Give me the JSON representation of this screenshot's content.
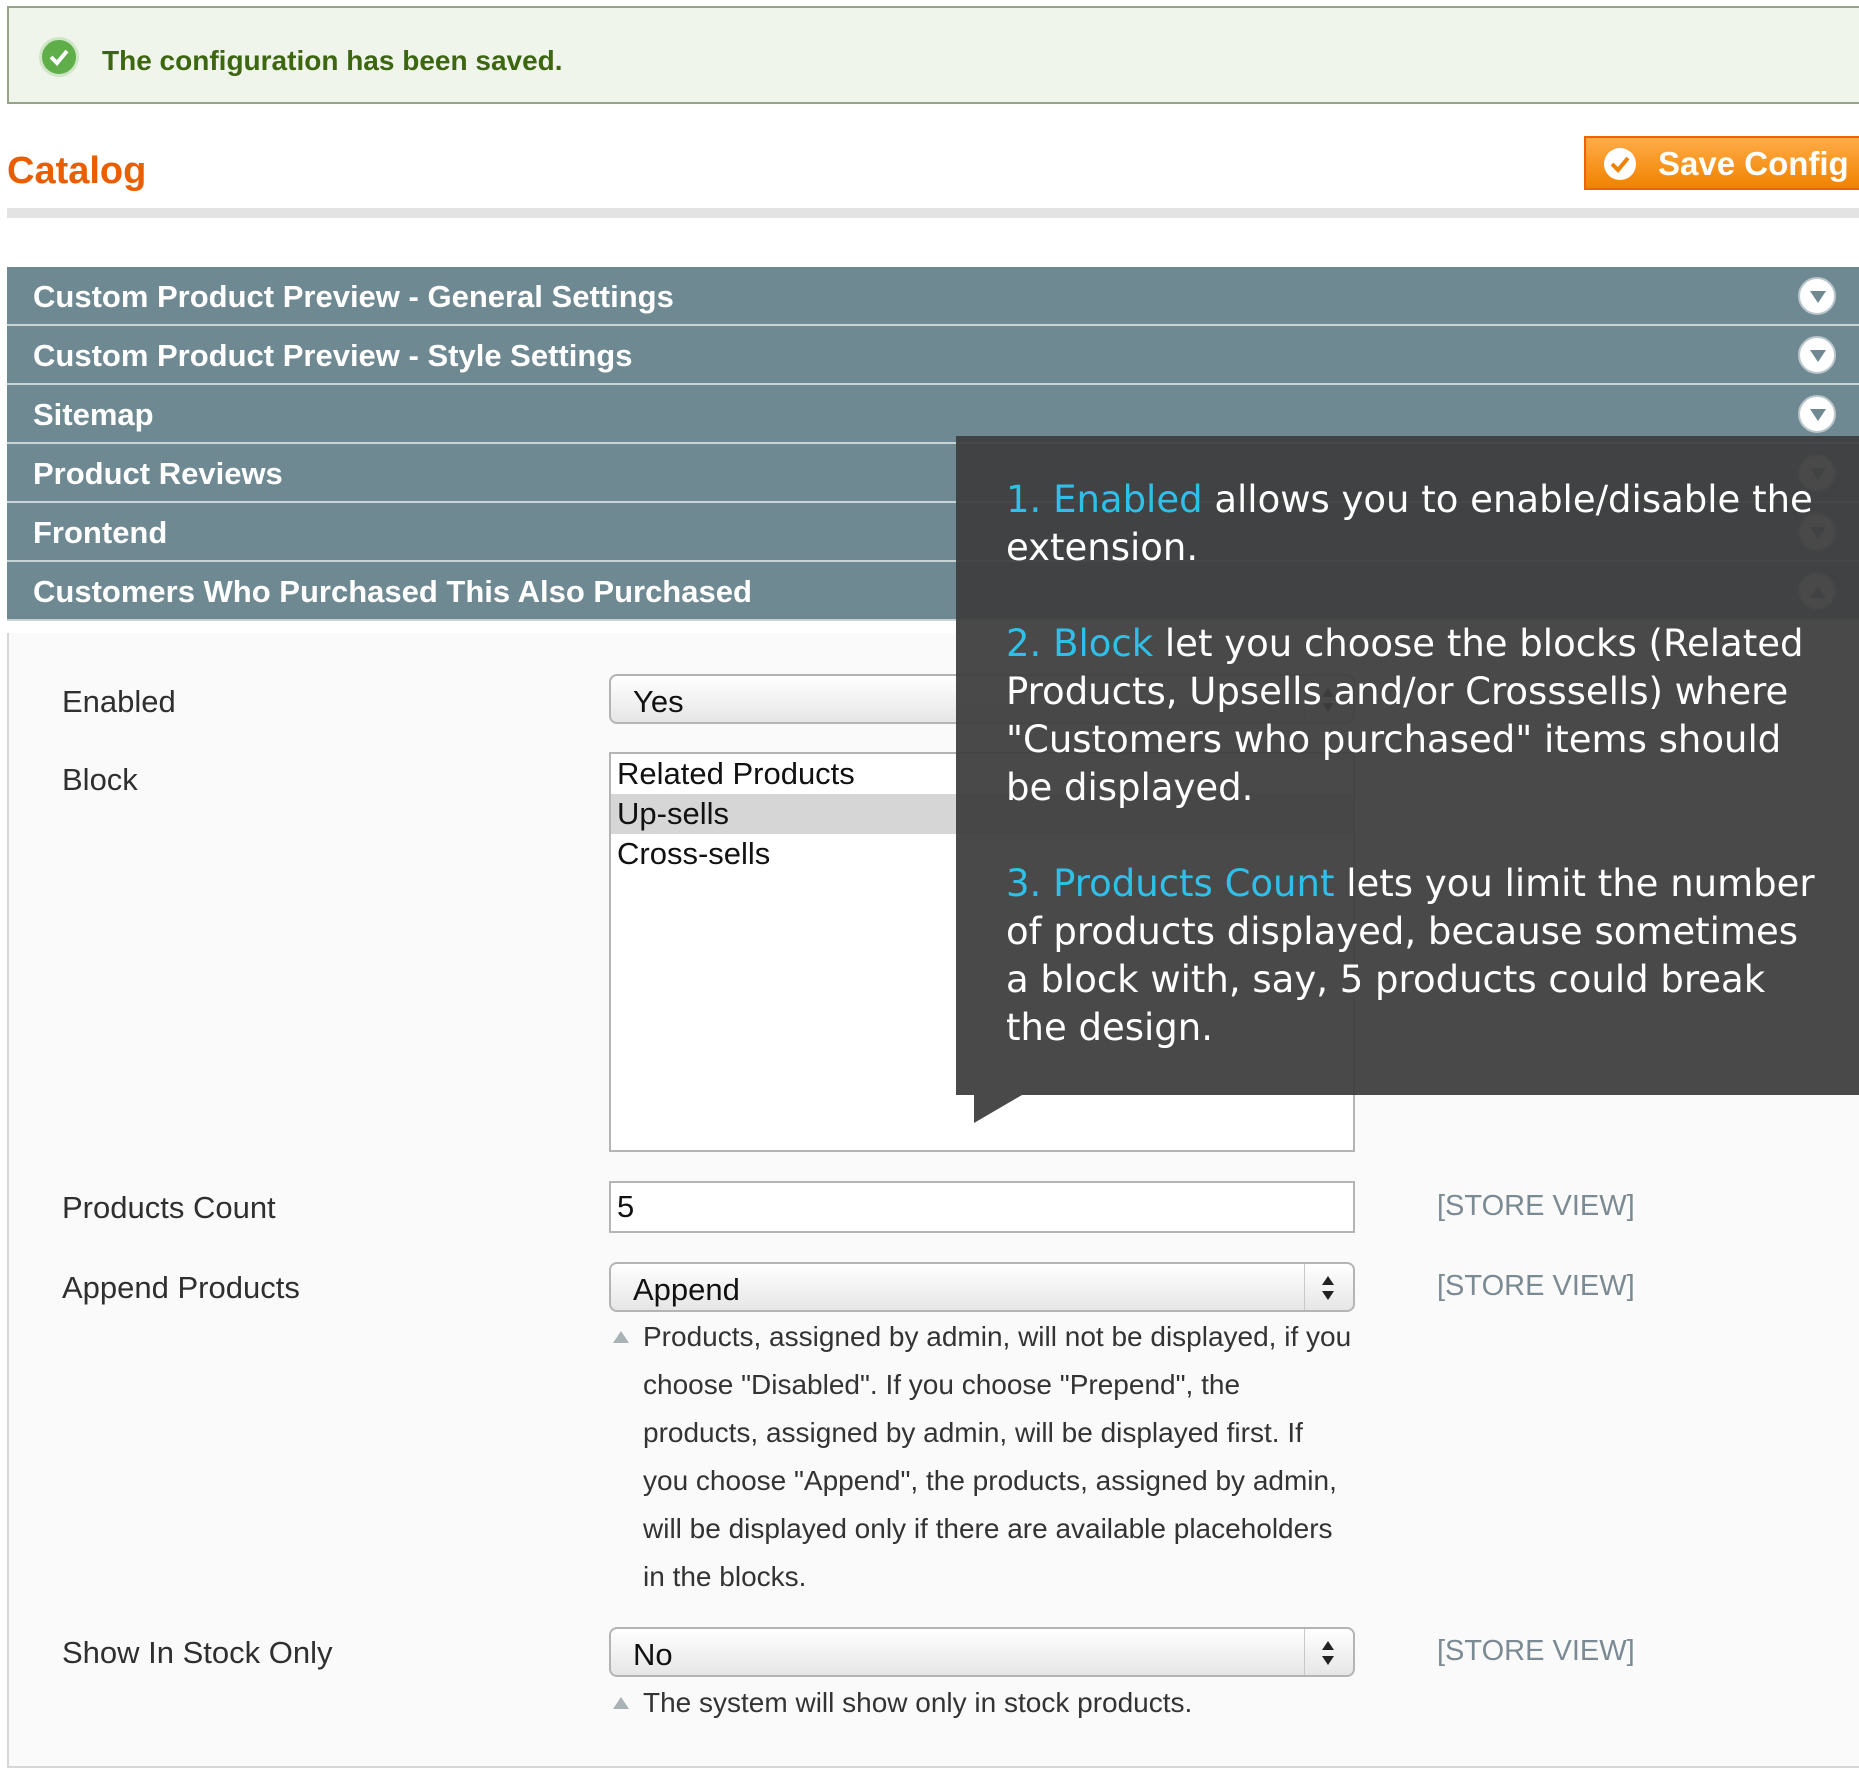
{
  "message": {
    "text": "The configuration has been saved."
  },
  "header": {
    "title": "Catalog",
    "save_label": "Save Config"
  },
  "sections": [
    {
      "title": "Custom Product Preview - General Settings"
    },
    {
      "title": "Custom Product Preview - Style Settings"
    },
    {
      "title": "Sitemap"
    },
    {
      "title": "Product Reviews"
    },
    {
      "title": "Frontend"
    },
    {
      "title": "Customers Who Purchased This Also Purchased"
    }
  ],
  "fields": {
    "enabled": {
      "label": "Enabled",
      "value": "Yes"
    },
    "block": {
      "label": "Block",
      "options": [
        "Related Products",
        "Up-sells",
        "Cross-sells"
      ],
      "selected": "Up-sells"
    },
    "products_count": {
      "label": "Products Count",
      "value": "5",
      "scope": "[STORE VIEW]"
    },
    "append_products": {
      "label": "Append Products",
      "value": "Append",
      "scope": "[STORE VIEW]",
      "note": "Products, assigned by admin, will not be displayed, if you choose \"Disabled\". If you choose \"Prepend\", the products, assigned by admin, will be displayed first. If you choose \"Append\", the products, assigned by admin, will be displayed only if there are available placeholders in the blocks."
    },
    "show_in_stock_only": {
      "label": "Show In Stock Only",
      "value": "No",
      "scope": "[STORE VIEW]",
      "note": "The system will show only in stock products."
    }
  },
  "tooltip": {
    "items": [
      {
        "highlight": "1. Enabled",
        "text": " allows you to enable/disable the extension."
      },
      {
        "highlight": "2. Block",
        "text": " let you choose the blocks (Related Products, Upsells and/or Crosssells) where \"Customers who purchased\" items should be displayed."
      },
      {
        "highlight": "3. Products Count",
        "text": " lets you limit the number of products displayed, because sometimes a block with, say, 5 products could break the design."
      }
    ]
  },
  "colors": {
    "accent_orange": "#eb5e00",
    "section_header": "#6f8992",
    "tooltip_highlight": "#2fc0ea",
    "success_green": "#3d6611"
  },
  "icons": {
    "message": "success-check-icon",
    "save": "check-icon",
    "section_toggle": "chevron-down-icon",
    "select": "select-arrows-icon"
  }
}
